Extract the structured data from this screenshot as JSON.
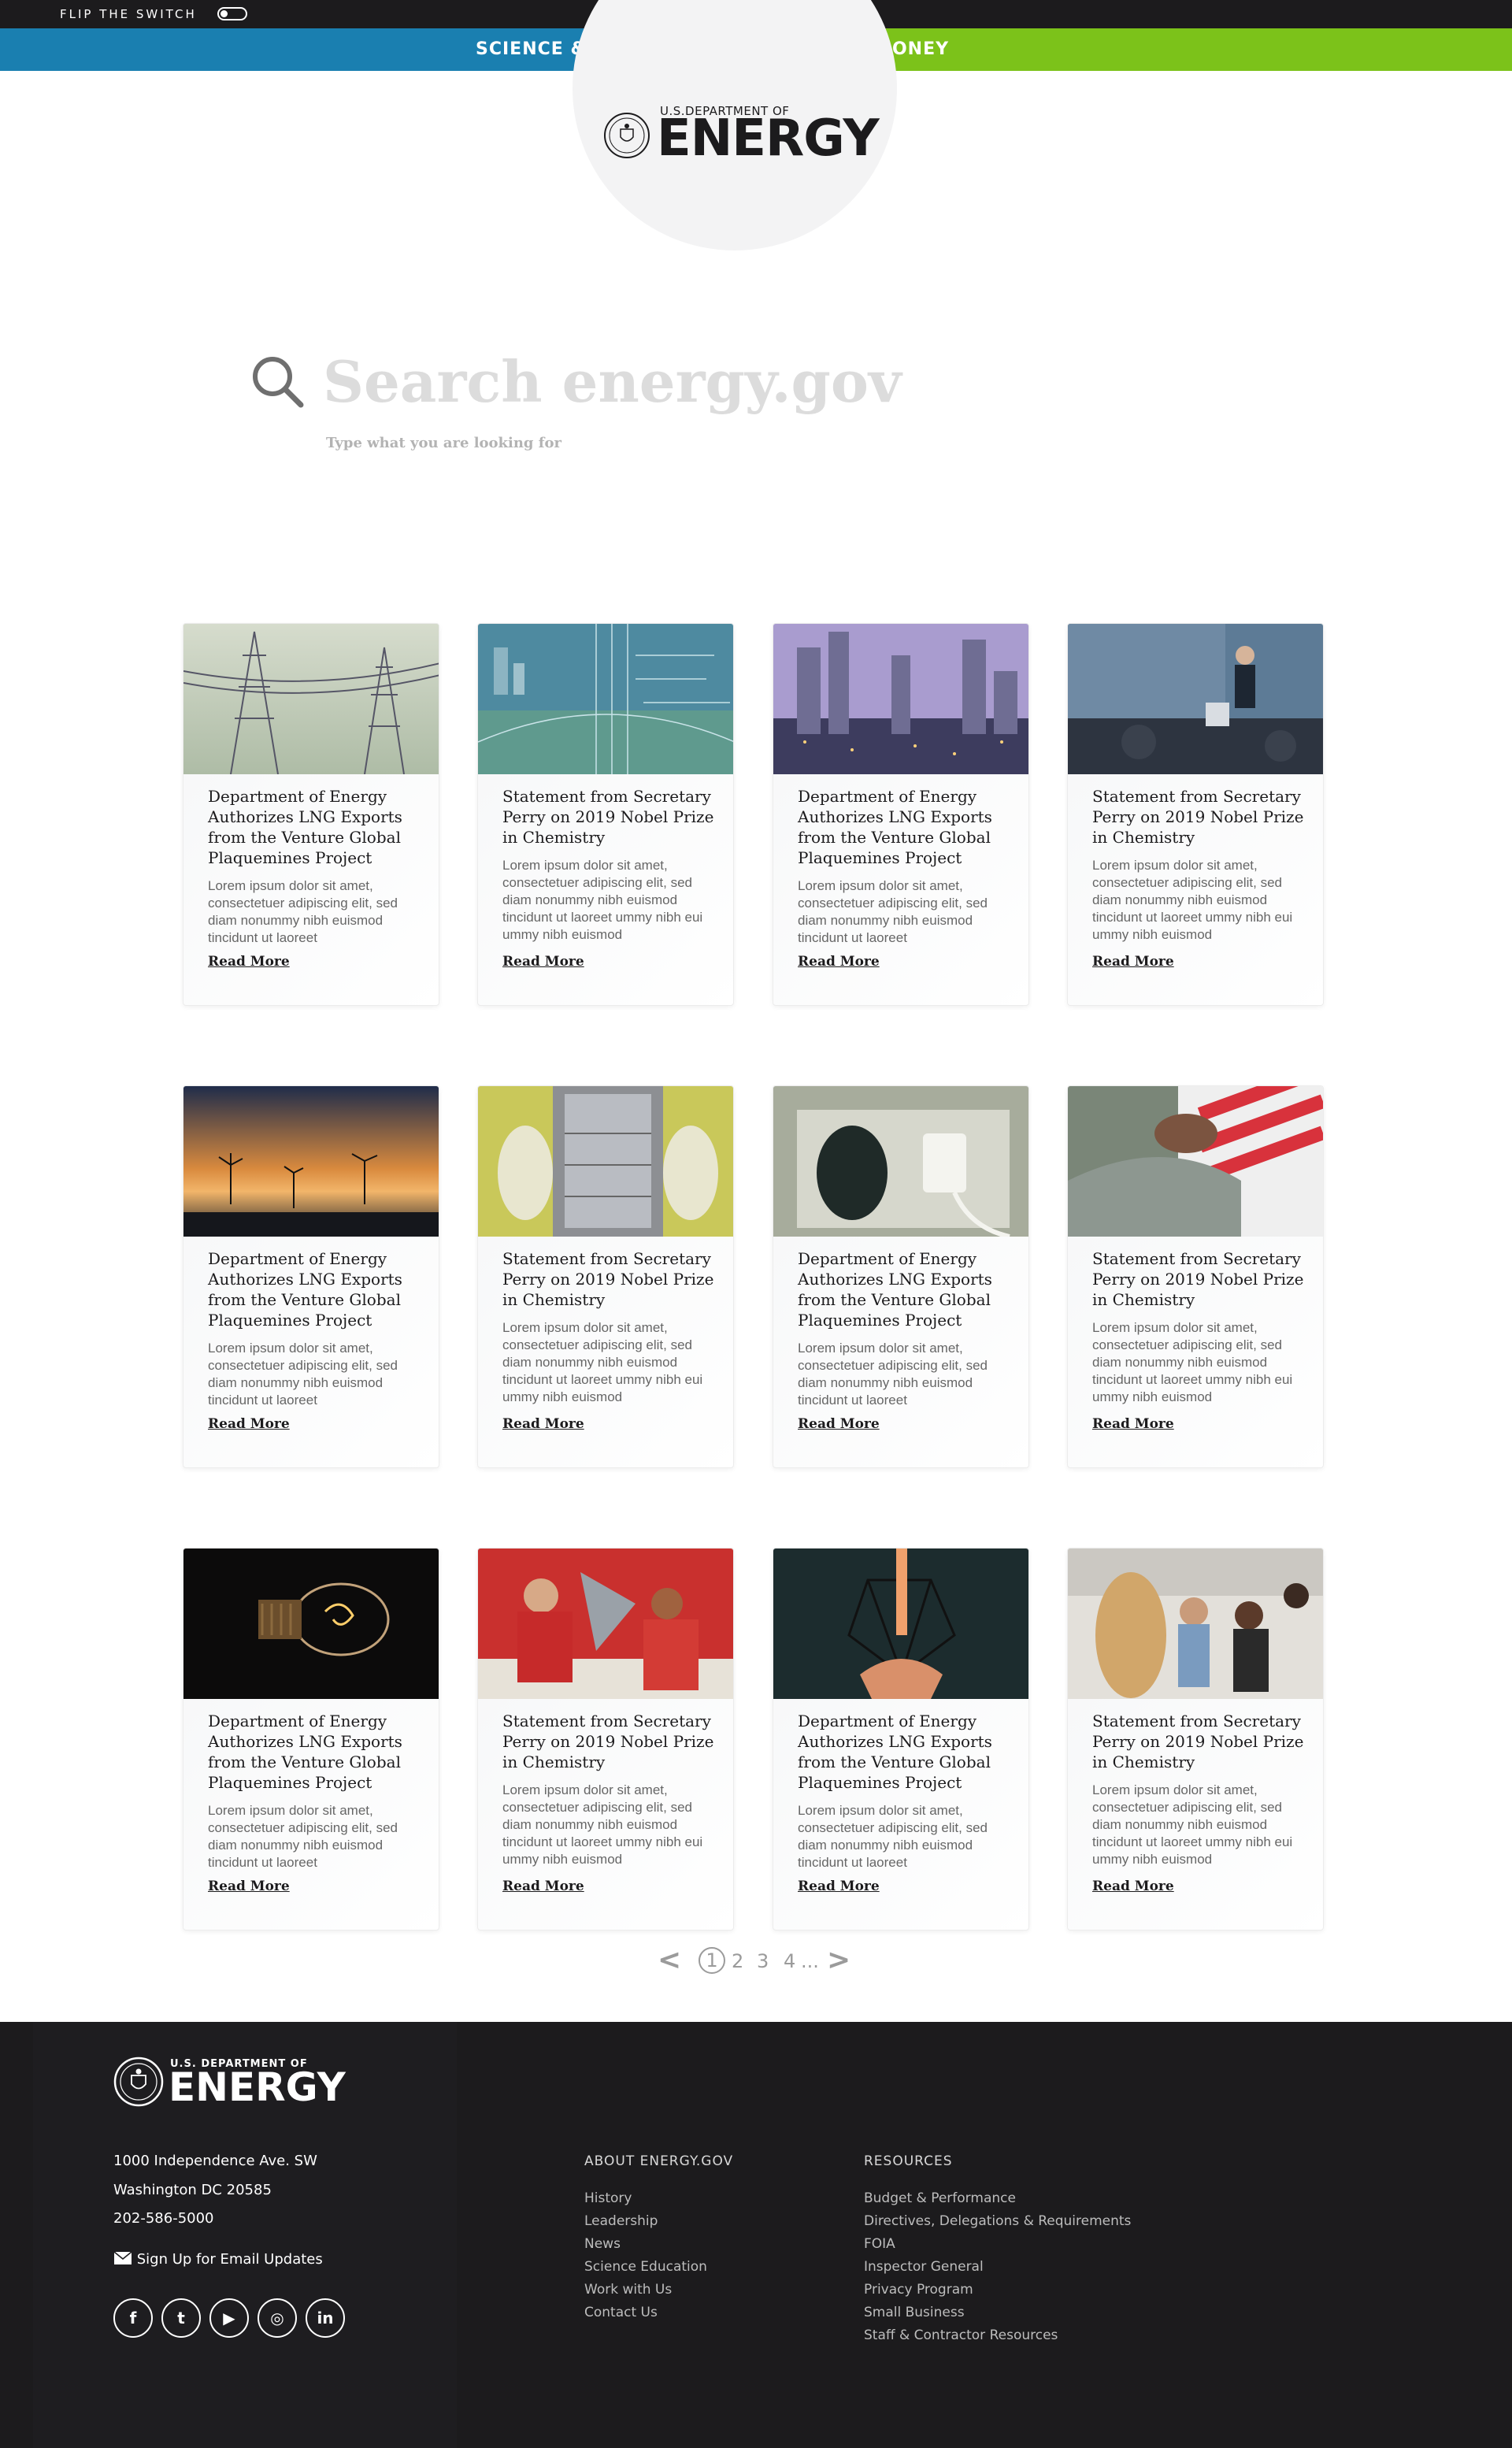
{
  "topbar": {
    "flip_label": "FLIP THE SWITCH"
  },
  "tabs": [
    {
      "label": "SCIENCE & EDUCATION",
      "color": "#1a7fb0"
    },
    {
      "label": "SAVE MONEY",
      "color": "#7cc21a"
    }
  ],
  "logo": {
    "sub": "U.S.DEPARTMENT OF",
    "main": "ENERGY"
  },
  "search": {
    "placeholder": "Search energy.gov",
    "hint": "Type what you are looking for"
  },
  "cards": [
    {
      "title": "Department of Energy Authorizes LNG  Exports from the  Venture Global Plaquemines Project",
      "body": "Lorem ipsum dolor sit amet, consectetuer adipiscing elit, sed diam nonummy nibh euismod tincidunt ut laoreet",
      "link": "Read More",
      "image": "power-lines-image"
    },
    {
      "title": "Statement from Secretary Perry on 2019 Nobel Prize in Chemistry",
      "body": "Lorem ipsum dolor sit amet, consectetuer adipiscing elit, sed diam nonummy nibh euismod tincidunt ut laoreet ummy nibh eui ummy nibh euismod",
      "link": "Read More",
      "image": "circuit-city-image"
    },
    {
      "title": "Department of Energy Authorizes LNG  Exports from the  Venture Global Plaquemines Project",
      "body": "Lorem ipsum dolor sit amet, consectetuer adipiscing elit, sed diam nonummy nibh euismod tincidunt ut laoreet",
      "link": "Read More",
      "image": "city-dusk-image"
    },
    {
      "title": "Statement from Secretary Perry on 2019 Nobel Prize in Chemistry",
      "body": "Lorem ipsum dolor sit amet, consectetuer adipiscing elit, sed diam nonummy nibh euismod tincidunt ut laoreet ummy nibh eui ummy nibh euismod",
      "link": "Read More",
      "image": "speaker-podium-image"
    },
    {
      "title": "Department of Energy Authorizes LNG  Exports from the  Venture Global Plaquemines Project",
      "body": "Lorem ipsum dolor sit amet, consectetuer adipiscing elit, sed diam nonummy nibh euismod tincidunt ut laoreet",
      "link": "Read More",
      "image": "wind-turbines-sunset-image"
    },
    {
      "title": "Statement from Secretary Perry on 2019 Nobel Prize in Chemistry",
      "body": "Lorem ipsum dolor sit amet, consectetuer adipiscing elit, sed diam nonummy nibh euismod tincidunt ut laoreet ummy nibh eui ummy nibh euismod",
      "link": "Read More",
      "image": "lab-equipment-image"
    },
    {
      "title": "Department of Energy Authorizes LNG  Exports from the  Venture Global Plaquemines Project",
      "body": "Lorem ipsum dolor sit amet, consectetuer adipiscing elit, sed diam nonummy nibh euismod tincidunt ut laoreet",
      "link": "Read More",
      "image": "wall-outlet-image"
    },
    {
      "title": "Statement from Secretary Perry on 2019 Nobel Prize in Chemistry",
      "body": "Lorem ipsum dolor sit amet, consectetuer adipiscing elit, sed diam nonummy nibh euismod tincidunt ut laoreet ummy nibh eui ummy nibh euismod",
      "link": "Read More",
      "image": "salute-flag-image"
    },
    {
      "title": "Department of Energy Authorizes LNG  Exports from the  Venture Global Plaquemines Project",
      "body": "Lorem ipsum dolor sit amet, consectetuer adipiscing elit, sed diam nonummy nibh euismod tincidunt ut laoreet",
      "link": "Read More",
      "image": "light-bulb-image"
    },
    {
      "title": "Statement from Secretary Perry on 2019 Nobel Prize in Chemistry",
      "body": "Lorem ipsum dolor sit amet, consectetuer adipiscing elit, sed diam nonummy nibh euismod tincidunt ut laoreet ummy nibh eui ummy nibh euismod",
      "link": "Read More",
      "image": "students-robot-image"
    },
    {
      "title": "Department of Energy Authorizes LNG  Exports from the  Venture Global Plaquemines Project",
      "body": "Lorem ipsum dolor sit amet, consectetuer adipiscing elit, sed diam nonummy nibh euismod tincidunt ut laoreet",
      "link": "Read More",
      "image": "pendant-lamp-image"
    },
    {
      "title": "Statement from Secretary Perry on 2019 Nobel Prize in Chemistry",
      "body": "Lorem ipsum dolor sit amet, consectetuer adipiscing elit, sed diam nonummy nibh euismod tincidunt ut laoreet ummy nibh eui ummy nibh euismod",
      "link": "Read More",
      "image": "classroom-image"
    }
  ],
  "pagination": {
    "prev": "<",
    "current": "1",
    "pages": [
      "2",
      "3",
      "4"
    ],
    "ellipsis": "...",
    "next": ">"
  },
  "footer": {
    "logo_sub": "U.S. DEPARTMENT OF",
    "logo_main": "ENERGY",
    "address": [
      "1000 Independence Ave. SW",
      "Washington DC 20585",
      "202-586-5000"
    ],
    "signup": "Sign Up for Email Updates",
    "social": [
      {
        "icon": "facebook-icon",
        "glyph": "f"
      },
      {
        "icon": "twitter-icon",
        "glyph": "t"
      },
      {
        "icon": "youtube-icon",
        "glyph": "▶"
      },
      {
        "icon": "instagram-icon",
        "glyph": "◎"
      },
      {
        "icon": "linkedin-icon",
        "glyph": "in"
      }
    ],
    "about_heading": "ABOUT ENERGY.GOV",
    "about_links": [
      "History",
      "Leadership",
      "News",
      "Science Education",
      "Work with Us",
      "Contact Us"
    ],
    "resources_heading": "RESOURCES",
    "resources_links": [
      "Budget & Performance",
      "Directives, Delegations & Requirements",
      "FOIA",
      "Inspector General",
      "Privacy Program",
      "Small Business",
      "Staff & Contractor Resources"
    ]
  }
}
